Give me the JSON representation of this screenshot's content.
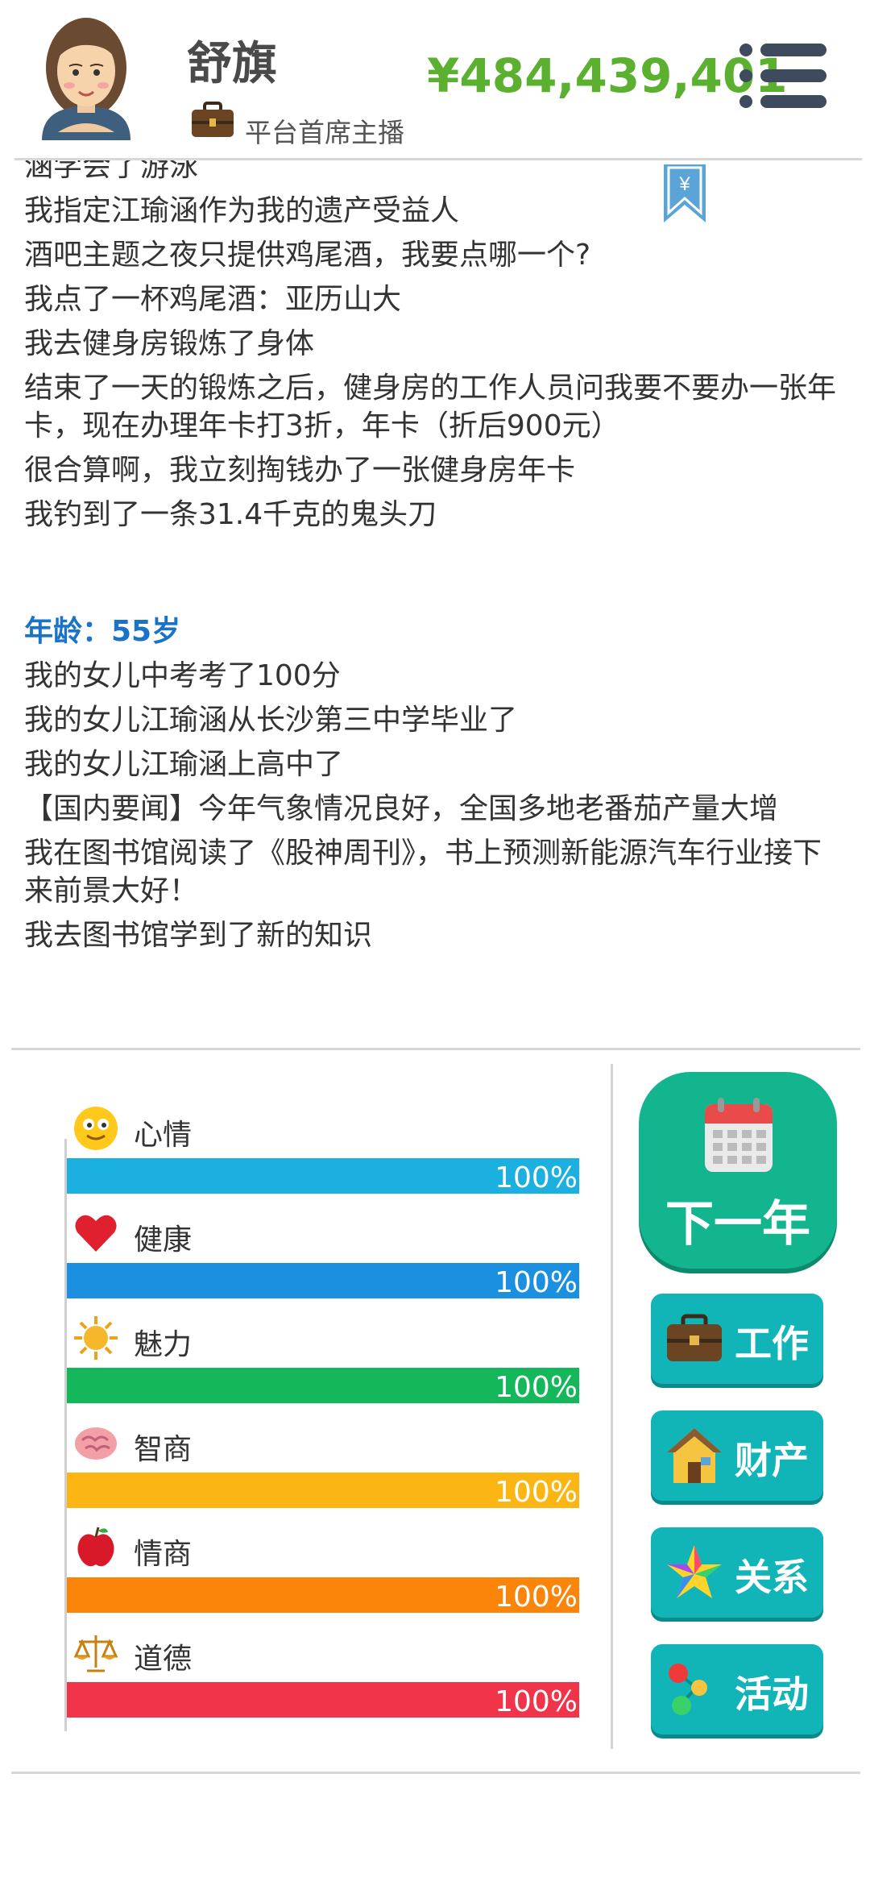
{
  "header": {
    "name": "舒旗",
    "job_title": "平台首席主播",
    "money": "¥484,439,401"
  },
  "log": {
    "partial_first_line": "涵学会了游泳",
    "lines_before": [
      "我指定江瑜涵作为我的遗产受益人",
      "酒吧主题之夜只提供鸡尾酒，我要点哪一个?",
      "我点了一杯鸡尾酒：亚历山大",
      "我去健身房锻炼了身体",
      "结束了一天的锻炼之后，健身房的工作人员问我要不要办一张年卡，现在办理年卡打3折，年卡（折后900元）",
      "很合算啊，我立刻掏钱办了一张健身房年卡",
      "我钓到了一条31.4千克的鬼头刀"
    ],
    "age_heading": "年龄：55岁",
    "lines_after": [
      "我的女儿中考考了100分",
      "我的女儿江瑜涵从长沙第三中学毕业了",
      "我的女儿江瑜涵上高中了",
      "【国内要闻】今年气象情况良好，全国多地老番茄产量大增",
      "我在图书馆阅读了《股神周刊》，书上预测新能源汽车行业接下来前景大好！",
      "我去图书馆学到了新的知识"
    ]
  },
  "stats": [
    {
      "label": "心情",
      "value": 100,
      "pct_text": "100%",
      "color": "#1bb0e0",
      "icon": "smiley-icon"
    },
    {
      "label": "健康",
      "value": 100,
      "pct_text": "100%",
      "color": "#1b8fe0",
      "icon": "heart-icon"
    },
    {
      "label": "魅力",
      "value": 100,
      "pct_text": "100%",
      "color": "#14b85a",
      "icon": "sun-icon"
    },
    {
      "label": "智商",
      "value": 100,
      "pct_text": "100%",
      "color": "#fbb614",
      "icon": "brain-icon"
    },
    {
      "label": "情商",
      "value": 100,
      "pct_text": "100%",
      "color": "#fb850b",
      "icon": "apple-icon"
    },
    {
      "label": "道德",
      "value": 100,
      "pct_text": "100%",
      "color": "#f0344a",
      "icon": "scales-icon"
    }
  ],
  "actions": {
    "next_year": "下一年",
    "work": "工作",
    "property": "财产",
    "relations": "关系",
    "activities": "活动"
  },
  "colors": {
    "money": "#5cb030",
    "age_heading": "#1a73c8",
    "next_year_button": "#13b58f",
    "action_button": "#11b5b8"
  }
}
